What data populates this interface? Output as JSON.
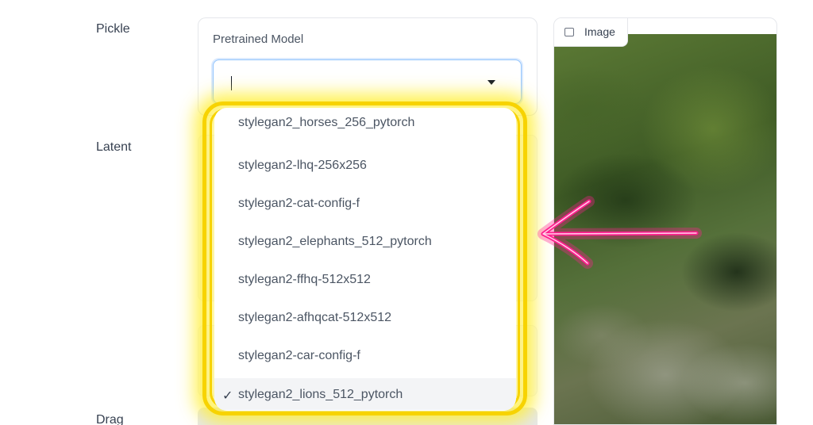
{
  "sidebar_labels": {
    "pickle": "Pickle",
    "latent": "Latent",
    "drag": "Drag"
  },
  "pretrained_model": {
    "title": "Pretrained Model",
    "value": ""
  },
  "dropdown": {
    "options": [
      "stylegan2_horses_256_pytorch",
      "stylegan2-lhq-256x256",
      "stylegan2-cat-config-f",
      "stylegan2_elephants_512_pytorch",
      "stylegan2-ffhq-512x512",
      "stylegan2-afhqcat-512x512",
      "stylegan2-car-config-f",
      "stylegan2_lions_512_pytorch"
    ],
    "selected": "stylegan2_lions_512_pytorch",
    "check_glyph": "✓"
  },
  "image_panel": {
    "tab_label": "Image"
  },
  "annotation": {
    "highlight_color": "#f7d300",
    "arrow_color": "#ff1f8e"
  },
  "icons": {
    "image_tab": "image-icon",
    "select_arrow": "chevron-down-icon",
    "pointer": "arrow-left-icon"
  }
}
